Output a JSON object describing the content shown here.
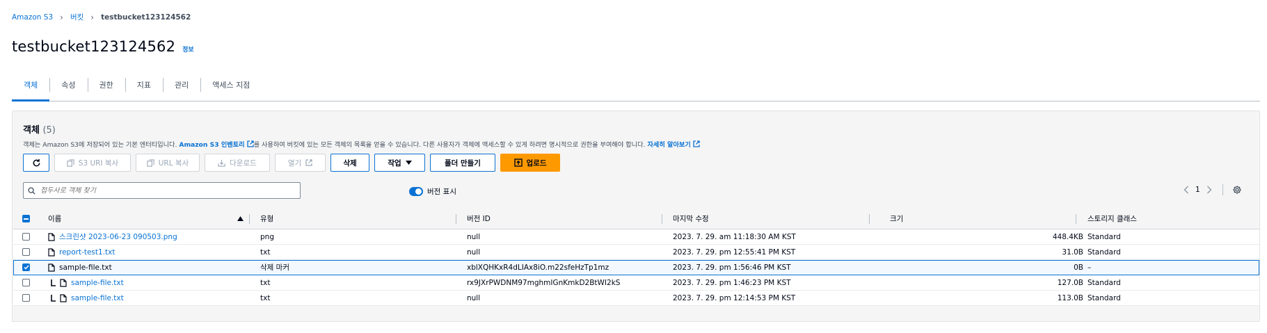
{
  "breadcrumb": {
    "root": "Amazon S3",
    "buckets": "버킷",
    "current": "testbucket123124562"
  },
  "header": {
    "title": "testbucket123124562",
    "info": "정보"
  },
  "tabs": [
    "객체",
    "속성",
    "권한",
    "지표",
    "관리",
    "액세스 지점"
  ],
  "objects": {
    "title": "객체",
    "count": "(5)",
    "desc_part1": "객체는 Amazon S3에 저장되어 있는 기본 엔터티입니다. ",
    "desc_link1": "Amazon S3 인벤토리",
    "desc_part2": "를 사용하여 버킷에 있는 모든 객체의 목록을 얻을 수 있습니다. 다른 사용자가 객체에 액세스할 수 있게 하려면 명시적으로 권한을 부여해야 합니다. ",
    "desc_link2": "자세히 알아보기",
    "buttons": {
      "copy_s3_uri": "S3 URI 복사",
      "copy_url": "URL 복사",
      "download": "다운로드",
      "open": "열기",
      "delete": "삭제",
      "actions": "작업",
      "create_folder": "폴더 만들기",
      "upload": "업로드"
    },
    "search_placeholder": "접두사로 객체 찾기",
    "show_versions": "버전 표시",
    "page": "1",
    "columns": {
      "name": "이름",
      "type": "유형",
      "version": "버전 ID",
      "modified": "마지막 수정",
      "size": "크기",
      "storage": "스토리지 클래스"
    },
    "rows": [
      {
        "name": "스크린샷 2023-06-23 090503.png",
        "type": "png",
        "version": "null",
        "modified": "2023. 7. 29. am 11:18:30 AM KST",
        "size": "448.4KB",
        "storage": "Standard"
      },
      {
        "name": "report-test1.txt",
        "type": "txt",
        "version": "null",
        "modified": "2023. 7. 29. pm 12:55:41 PM KST",
        "size": "31.0B",
        "storage": "Standard"
      },
      {
        "name": "sample-file.txt",
        "type": "삭제 마커",
        "version": "xblXQHKxR4dLIAx8iO.m22sfeHzTp1mz",
        "modified": "2023. 7. 29. pm 1:56:46 PM KST",
        "size": "0B",
        "storage": "–"
      },
      {
        "name": "sample-file.txt",
        "type": "txt",
        "version": "rx9JXrPWDNM97mghmIGnKmkD2BtWI2kS",
        "modified": "2023. 7. 29. pm 1:46:23 PM KST",
        "size": "127.0B",
        "storage": "Standard"
      },
      {
        "name": "sample-file.txt",
        "type": "txt",
        "version": "null",
        "modified": "2023. 7. 29. pm 12:14:53 PM KST",
        "size": "113.0B",
        "storage": "Standard"
      }
    ]
  },
  "colors": {
    "accent": "#0972d3",
    "primary_button": "#ff9900"
  }
}
